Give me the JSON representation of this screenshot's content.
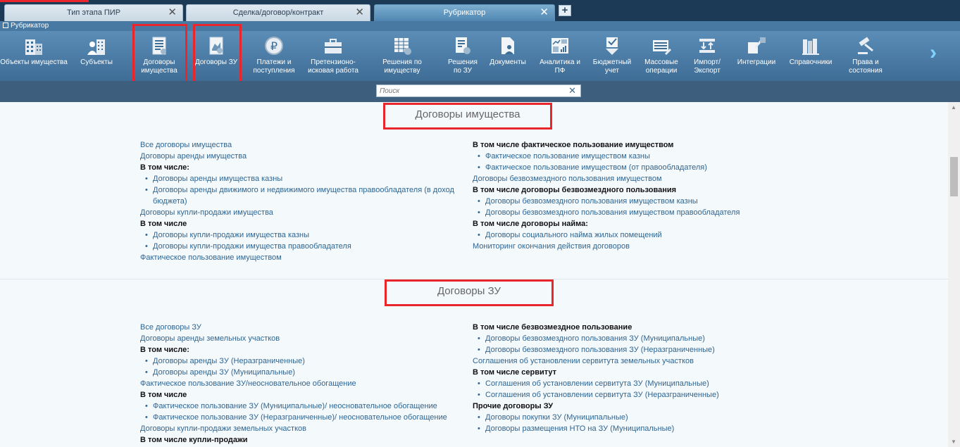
{
  "tabs": [
    {
      "label": "Тип этапа ПИР",
      "active": false
    },
    {
      "label": "Сделка/договор/контракт",
      "active": false
    },
    {
      "label": "Рубрикатор",
      "active": true
    }
  ],
  "breadcrumb": {
    "label": "Рубрикатор"
  },
  "toolbar": {
    "items": [
      {
        "label1": "Объекты имущества",
        "label2": "",
        "icon": "building-icon"
      },
      {
        "label1": "Субъекты",
        "label2": "",
        "icon": "people-building-icon"
      },
      {
        "label1": "Договоры",
        "label2": "имущества",
        "icon": "contract-document-icon"
      },
      {
        "label1": "Договоры ЗУ",
        "label2": "",
        "icon": "land-contract-icon"
      },
      {
        "label1": "Платежи и",
        "label2": "поступления",
        "icon": "ruble-coin-icon"
      },
      {
        "label1": "Претензионо-",
        "label2": "исковая работа",
        "icon": "briefcase-icon"
      },
      {
        "label1": "Решения по",
        "label2": "имуществу",
        "icon": "spreadsheet-gear-icon"
      },
      {
        "label1": "Решения",
        "label2": "по ЗУ",
        "icon": "document-gear-icon"
      },
      {
        "label1": "Документы",
        "label2": "",
        "icon": "document-user-icon"
      },
      {
        "label1": "Аналитика и",
        "label2": "ПФ",
        "icon": "analytics-charts-icon"
      },
      {
        "label1": "Бюджетный",
        "label2": "учет",
        "icon": "checkbox-arrow-icon"
      },
      {
        "label1": "Массовые",
        "label2": "операции",
        "icon": "table-edit-icon"
      },
      {
        "label1": "Импорт/",
        "label2": "Экспорт",
        "icon": "import-export-icon"
      },
      {
        "label1": "Интеграции",
        "label2": "",
        "icon": "integration-icon"
      },
      {
        "label1": "Справочники",
        "label2": "",
        "icon": "books-icon"
      },
      {
        "label1": "Права и",
        "label2": "состояния",
        "icon": "gavel-icon"
      }
    ]
  },
  "search": {
    "placeholder": "Поиск"
  },
  "sections": {
    "property": {
      "title": "Договоры имущества",
      "left": [
        {
          "t": "link",
          "text": "Все договоры имущества"
        },
        {
          "t": "link",
          "text": "Договоры аренды имущества"
        },
        {
          "t": "head",
          "text": "В том числе:"
        },
        {
          "t": "sub",
          "text": "Договоры аренды имущества казны"
        },
        {
          "t": "sub",
          "text": "Договоры аренды движимого и недвижимого имущества правообладателя (в доход бюджета)"
        },
        {
          "t": "link",
          "text": "Договоры купли-продажи имущества"
        },
        {
          "t": "head",
          "text": "В том числе"
        },
        {
          "t": "sub",
          "text": "Договоры купли-продажи имущества казны"
        },
        {
          "t": "sub",
          "text": "Договоры купли-продажи имущества правообладателя"
        },
        {
          "t": "link",
          "text": "Фактическое пользование имуществом"
        }
      ],
      "right": [
        {
          "t": "head",
          "text": "В том числе фактическое пользование имуществом"
        },
        {
          "t": "sub",
          "text": "Фактическое пользование имуществом казны"
        },
        {
          "t": "sub",
          "text": "Фактическое пользование имуществом (от правообладателя)"
        },
        {
          "t": "link",
          "text": "Договоры безвозмездного пользования имуществом"
        },
        {
          "t": "head",
          "text": "В том числе договоры безвозмездного пользования"
        },
        {
          "t": "sub",
          "text": "Договоры безвозмездного пользования имуществом казны"
        },
        {
          "t": "sub",
          "text": "Договоры безвозмездного пользования имуществом правообладателя"
        },
        {
          "t": "head",
          "text": "В том числе договоры найма:"
        },
        {
          "t": "sub",
          "text": "Договоры социального найма жилых помещений"
        },
        {
          "t": "link",
          "text": "Мониторинг окончания действия договоров"
        }
      ]
    },
    "land": {
      "title": "Договоры ЗУ",
      "left": [
        {
          "t": "link",
          "text": "Все договоры ЗУ"
        },
        {
          "t": "link",
          "text": "Договоры аренды земельных участков"
        },
        {
          "t": "head",
          "text": "В том числе:"
        },
        {
          "t": "sub",
          "text": "Договоры аренды ЗУ (Неразграниченные)"
        },
        {
          "t": "sub",
          "text": "Договоры аренды ЗУ (Муниципальные)"
        },
        {
          "t": "link",
          "text": "Фактическое пользование ЗУ/неосновательное обогащение"
        },
        {
          "t": "head",
          "text": "В том числе"
        },
        {
          "t": "sub",
          "text": "Фактическое пользование ЗУ (Муниципальные)/ неосновательное обогащение"
        },
        {
          "t": "sub",
          "text": "Фактическое пользование ЗУ (Неразграниченные)/ неосновательное обогащение"
        },
        {
          "t": "link",
          "text": "Договоры купли-продажи земельных участков"
        },
        {
          "t": "head",
          "text": "В том числе купли-продажи"
        }
      ],
      "right": [
        {
          "t": "head",
          "text": "В том числе безвозмездное пользование"
        },
        {
          "t": "sub",
          "text": "Договоры безвозмездного пользования ЗУ (Муниципальные)"
        },
        {
          "t": "sub",
          "text": "Договоры безвозмездного пользования ЗУ (Неразграниченные)"
        },
        {
          "t": "link",
          "text": "Соглашения об установлении сервитута земельных участков"
        },
        {
          "t": "head",
          "text": "В том числе сервитут"
        },
        {
          "t": "sub",
          "text": "Соглашения об установлении сервитута ЗУ (Муниципальные)"
        },
        {
          "t": "sub",
          "text": "Соглашения об установлении сервитута ЗУ (Неразграниченные)"
        },
        {
          "t": "head",
          "text": "Прочие договоры ЗУ"
        },
        {
          "t": "sub",
          "text": "Договоры покупки ЗУ (Муниципальные)"
        },
        {
          "t": "sub",
          "text": "Договоры размещения НТО на ЗУ (Муниципальные)"
        }
      ]
    }
  },
  "colors": {
    "highlight": "#e8262c",
    "link": "#2f6591",
    "toolbar": "#4f80aa"
  }
}
